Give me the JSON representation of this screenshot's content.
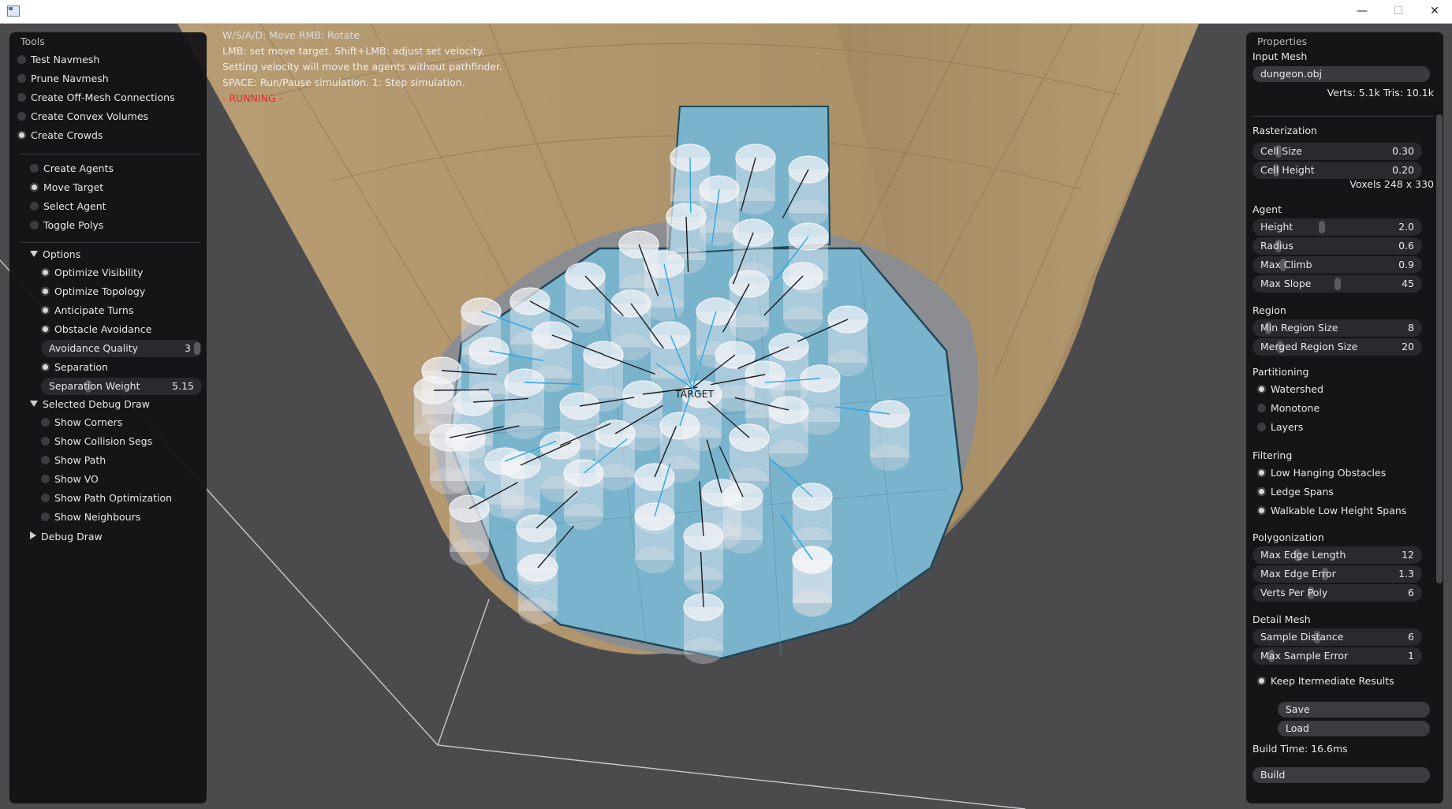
{
  "window": {
    "minimize_glyph": "—",
    "maximize_glyph": "☐",
    "close_glyph": "✕"
  },
  "help": {
    "line1": "W/S/A/D: Move  RMB: Rotate",
    "line2": "LMB: set move target.  Shift+LMB: adjust set velocity.",
    "line3": "Setting velocity will move the agents without pathfinder.",
    "line4": "SPACE: Run/Pause simulation.  1: Step simulation.",
    "line5": "- RUNNING -",
    "target_label": "TARGET",
    "running_color": "#e02a2a"
  },
  "tools": {
    "title": "Tools",
    "items": [
      {
        "label": "Test Navmesh",
        "checked": false
      },
      {
        "label": "Prune Navmesh",
        "checked": false
      },
      {
        "label": "Create Off-Mesh Connections",
        "checked": false
      },
      {
        "label": "Create Convex Volumes",
        "checked": false
      },
      {
        "label": "Create Crowds",
        "checked": true
      }
    ],
    "modes": [
      {
        "label": "Create Agents",
        "checked": false
      },
      {
        "label": "Move Target",
        "checked": true
      },
      {
        "label": "Select Agent",
        "checked": false
      },
      {
        "label": "Toggle Polys",
        "checked": false
      }
    ],
    "options_label": "Options",
    "options": [
      {
        "label": "Optimize Visibility",
        "checked": true
      },
      {
        "label": "Optimize Topology",
        "checked": true
      },
      {
        "label": "Anticipate Turns",
        "checked": true
      },
      {
        "label": "Obstacle Avoidance",
        "checked": true
      }
    ],
    "avoidance_quality": {
      "label": "Avoidance Quality",
      "value": "3",
      "level": 1.0
    },
    "separation": {
      "label": "Separation",
      "checked": true
    },
    "separation_weight": {
      "label": "Separation Weight",
      "value": "5.15",
      "level": 0.26
    },
    "debug_label": "Selected Debug Draw",
    "debug_items": [
      {
        "label": "Show Corners",
        "checked": false
      },
      {
        "label": "Show Collision Segs",
        "checked": false
      },
      {
        "label": "Show Path",
        "checked": false
      },
      {
        "label": "Show VO",
        "checked": false
      },
      {
        "label": "Show Path Optimization",
        "checked": false
      },
      {
        "label": "Show Neighbours",
        "checked": false
      }
    ],
    "debug_draw_label": "Debug Draw"
  },
  "props": {
    "title": "Properties",
    "input_mesh_label": "Input Mesh",
    "mesh_file": "dungeon.obj",
    "mesh_stats": "Verts: 5.1k  Tris: 10.1k",
    "rasterization_label": "Rasterization",
    "cell_size": {
      "label": "Cell Size",
      "value": "0.30",
      "level": 0.12
    },
    "cell_height": {
      "label": "Cell Height",
      "value": "0.20",
      "level": 0.1
    },
    "voxels": "Voxels  248 x 330",
    "agent_label": "Agent",
    "agent_height": {
      "label": "Height",
      "value": "2.0",
      "level": 0.4
    },
    "agent_radius": {
      "label": "Radius",
      "value": "0.6",
      "level": 0.12
    },
    "agent_climb": {
      "label": "Max Climb",
      "value": "0.9",
      "level": 0.15
    },
    "agent_slope": {
      "label": "Max Slope",
      "value": "45",
      "level": 0.5
    },
    "region_label": "Region",
    "min_region": {
      "label": "Min Region Size",
      "value": "8",
      "level": 0.05
    },
    "merged_region": {
      "label": "Merged Region Size",
      "value": "20",
      "level": 0.13
    },
    "partitioning_label": "Partitioning",
    "partitioning": [
      {
        "label": "Watershed",
        "checked": true
      },
      {
        "label": "Monotone",
        "checked": false
      },
      {
        "label": "Layers",
        "checked": false
      }
    ],
    "filtering_label": "Filtering",
    "filtering": [
      {
        "label": "Low Hanging Obstacles",
        "checked": true
      },
      {
        "label": "Ledge Spans",
        "checked": true
      },
      {
        "label": "Walkable Low Height Spans",
        "checked": true
      }
    ],
    "polygonization_label": "Polygonization",
    "max_edge_len": {
      "label": "Max Edge Length",
      "value": "12",
      "level": 0.24
    },
    "max_edge_err": {
      "label": "Max Edge Error",
      "value": "1.3",
      "level": 0.42
    },
    "verts_per_poly": {
      "label": "Verts Per Poly",
      "value": "6",
      "level": 0.33
    },
    "detail_label": "Detail Mesh",
    "sample_dist": {
      "label": "Sample Distance",
      "value": "6",
      "level": 0.37
    },
    "sample_err": {
      "label": "Max Sample Error",
      "value": "1",
      "level": 0.07
    },
    "keep_intermediate": {
      "label": "Keep Itermediate Results",
      "checked": true
    },
    "save_label": "Save",
    "load_label": "Load",
    "build_time": "Build Time: 16.6ms",
    "build_label": "Build"
  }
}
